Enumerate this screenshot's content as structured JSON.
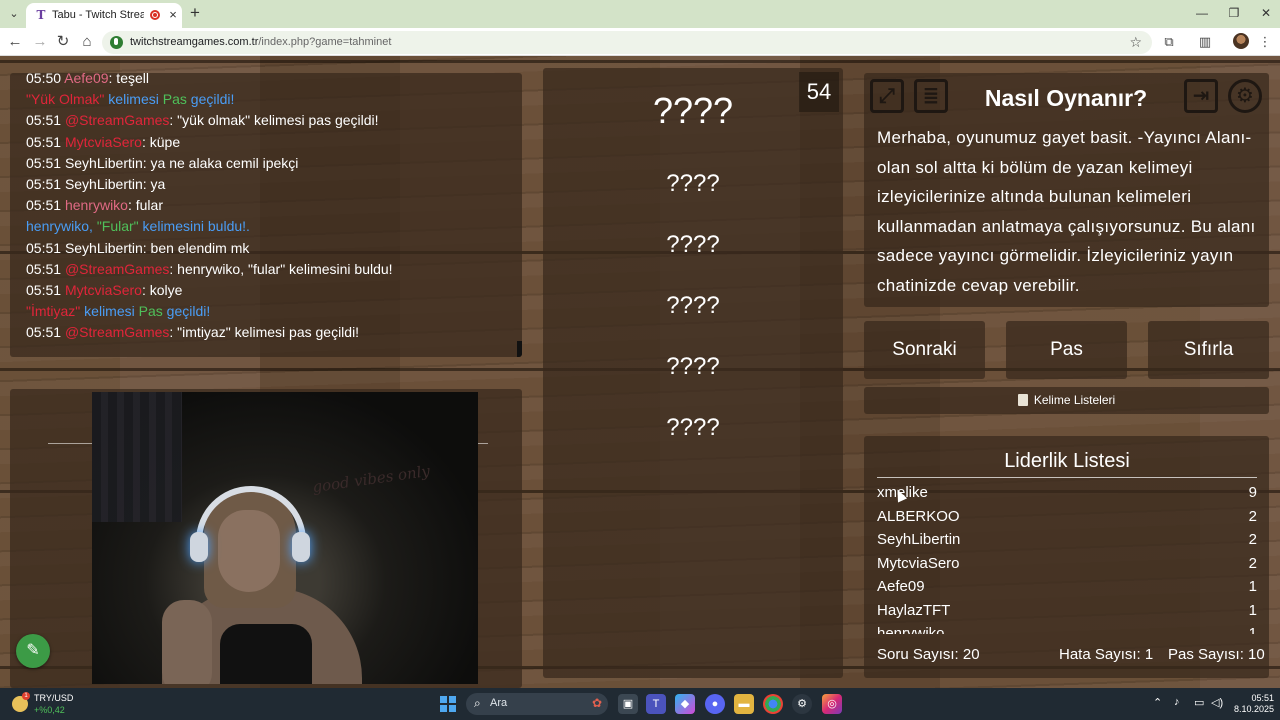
{
  "browser": {
    "tab_title": "Tabu - Twitch Stream Games",
    "url_host": "twitchstreamgames.com.tr",
    "url_path": "/index.php?game=tahminet"
  },
  "chat": {
    "lines": [
      {
        "time": "05:50",
        "user": "Aefe09",
        "user_color": "#e06a84",
        "text": ": teşell"
      },
      {
        "system": true,
        "parts": [
          {
            "t": "\"Yük Olmak\"",
            "c": "#e0253a"
          },
          {
            "t": " kelimesi ",
            "c": "#4a9df5"
          },
          {
            "t": "Pas",
            "c": "#4fc05a"
          },
          {
            "t": " geçildi!",
            "c": "#4a9df5"
          }
        ]
      },
      {
        "time": "05:51",
        "user": "@StreamGames",
        "user_color": "#e0253a",
        "text": ": \"yük olmak\" kelimesi pas geçildi!"
      },
      {
        "time": "05:51",
        "user": "MytcviaSero",
        "user_color": "#e0253a",
        "text": ": küpe"
      },
      {
        "time": "05:51",
        "user": "SeyhLibertin",
        "user_color": "#ffffff",
        "text": ": ya ne alaka cemil ipekçi"
      },
      {
        "time": "05:51",
        "user": "SeyhLibertin",
        "user_color": "#ffffff",
        "text": ": ya"
      },
      {
        "time": "05:51",
        "user": "henrywiko",
        "user_color": "#e06a84",
        "text": ": fular"
      },
      {
        "system": true,
        "parts": [
          {
            "t": "henrywiko, ",
            "c": "#4a9df5"
          },
          {
            "t": "\"Fular\"",
            "c": "#4fc05a"
          },
          {
            "t": " kelimesini buldu!.",
            "c": "#4a9df5"
          }
        ]
      },
      {
        "time": "05:51",
        "user": "SeyhLibertin",
        "user_color": "#ffffff",
        "text": ": ben elendim mk"
      },
      {
        "time": "05:51",
        "user": "@StreamGames",
        "user_color": "#e0253a",
        "text": ": henrywiko, \"fular\" kelimesini buldu!"
      },
      {
        "time": "05:51",
        "user": "MytcviaSero",
        "user_color": "#e0253a",
        "text": ": kolye"
      },
      {
        "system": true,
        "parts": [
          {
            "t": "\"İmtiyaz\"",
            "c": "#e0253a"
          },
          {
            "t": " kelimesi ",
            "c": "#4a9df5"
          },
          {
            "t": "Pas",
            "c": "#4fc05a"
          },
          {
            "t": " geçildi!",
            "c": "#4a9df5"
          }
        ]
      },
      {
        "time": "05:51",
        "user": "@StreamGames",
        "user_color": "#e0253a",
        "text": ": \"imtiyaz\" kelimesi pas geçildi!"
      }
    ]
  },
  "video": {
    "neon_text": "good vibes only"
  },
  "game": {
    "timer": "54",
    "words": [
      "????",
      "????",
      "????",
      "????",
      "????",
      "????"
    ]
  },
  "howto": {
    "title": "Nasıl Oynanır?",
    "text": "Merhaba, oyunumuz gayet basit. -Yayıncı Alanı- olan sol altta ki bölüm de yazan kelimeyi izleyicilerinize altında bulunan kelimeleri kullanmadan anlatmaya çalışıyorsunuz. Bu alanı sadece yayıncı görmelidir. İzleyicileriniz yayın chatinizde cevap verebilir."
  },
  "controls": {
    "next": "Sonraki",
    "pass": "Pas",
    "reset": "Sıfırla",
    "word_lists": "Kelime Listeleri"
  },
  "leaderboard": {
    "title": "Liderlik Listesi",
    "rows": [
      {
        "name": "xmelike",
        "score": "9"
      },
      {
        "name": "ALBERKOO",
        "score": "2"
      },
      {
        "name": "SeyhLibertin",
        "score": "2"
      },
      {
        "name": "MytcviaSero",
        "score": "2"
      },
      {
        "name": "Aefe09",
        "score": "1"
      },
      {
        "name": "HaylazTFT",
        "score": "1"
      },
      {
        "name": "henrywiko",
        "score": "1"
      }
    ],
    "question_count": "Soru Sayısı: 20",
    "error_count": "Hata Sayısı: 1",
    "pass_count": "Pas Sayısı: 10"
  },
  "taskbar": {
    "ticker_name": "TRY/USD",
    "ticker_value": "+%0,42",
    "search_placeholder": "Ara",
    "time": "05:51",
    "date": "8.10.2025"
  }
}
